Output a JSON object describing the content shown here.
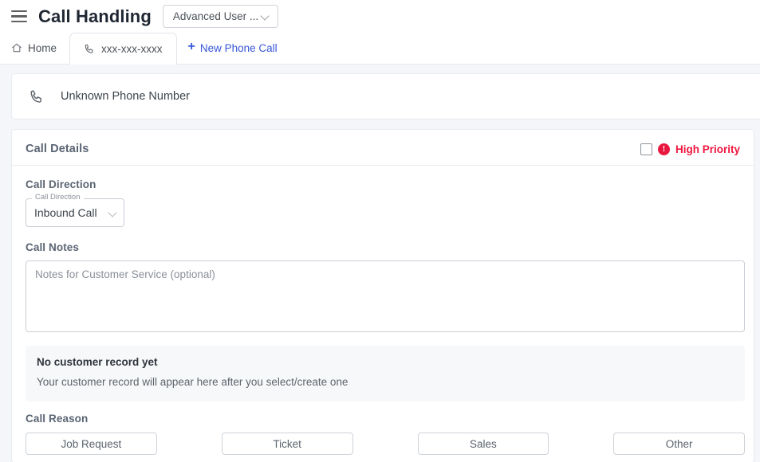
{
  "appbar": {
    "menu_icon": "hamburger-menu-icon",
    "title": "Call Handling",
    "user_select": {
      "value": "Advanced User ...",
      "chevron_icon": "chevron-down-icon"
    }
  },
  "tabs": {
    "home": {
      "label": "Home",
      "icon": "home-icon"
    },
    "call": {
      "label": "xxx-xxx-xxxx",
      "icon": "phone-icon"
    },
    "new_call": {
      "label": "New Phone Call",
      "icon": "plus-icon",
      "color": "#3657d8"
    }
  },
  "phone_header": {
    "icon": "phone-icon",
    "text": "Unknown Phone Number"
  },
  "call_details": {
    "title": "Call Details",
    "priority": {
      "checked": false,
      "icon": "error-exclamation-icon",
      "icon_glyph": "!",
      "label": "High Priority",
      "color": "#f0173f"
    },
    "direction": {
      "section_label": "Call Direction",
      "field_label": "Call Direction",
      "value": "Inbound Call",
      "chevron_icon": "chevron-down-icon"
    },
    "notes": {
      "section_label": "Call Notes",
      "value": "",
      "placeholder": "Notes for Customer Service (optional)"
    },
    "customer_record": {
      "title": "No customer record yet",
      "subtitle": "Your customer record will appear here after you select/create one"
    },
    "call_reason": {
      "section_label": "Call Reason",
      "options": [
        {
          "label": "Job Request"
        },
        {
          "label": "Ticket"
        },
        {
          "label": "Sales"
        },
        {
          "label": "Other"
        }
      ]
    }
  }
}
